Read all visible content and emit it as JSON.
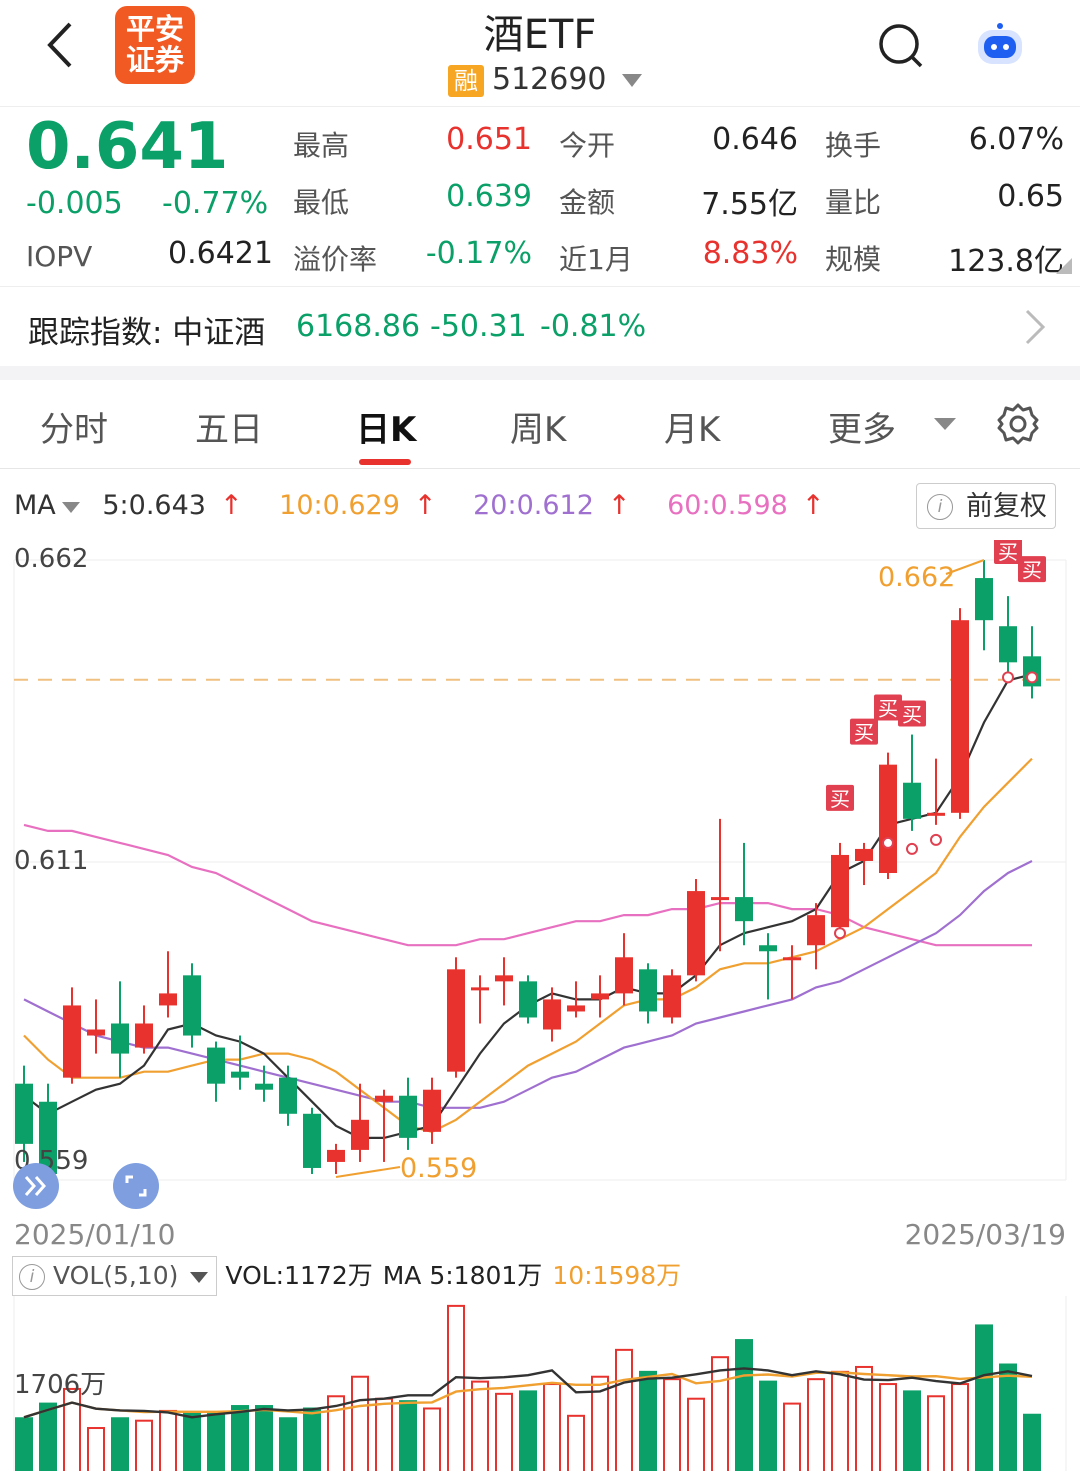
{
  "header": {
    "logo_line1": "平安",
    "logo_line2": "证券",
    "title": "酒ETF",
    "badge": "融",
    "code": "512690"
  },
  "quote": {
    "price": "0.641",
    "change": "-0.005",
    "change_pct": "-0.77%",
    "iopv_label": "IOPV",
    "iopv_value": "0.6421",
    "grid": [
      {
        "label": "最高",
        "value": "0.651",
        "color": "red"
      },
      {
        "label": "今开",
        "value": "0.646",
        "color": "dark"
      },
      {
        "label": "换手",
        "value": "6.07%",
        "color": "dark"
      },
      {
        "label": "最低",
        "value": "0.639",
        "color": "green"
      },
      {
        "label": "金额",
        "value": "7.55亿",
        "color": "dark"
      },
      {
        "label": "量比",
        "value": "0.65",
        "color": "dark"
      },
      {
        "label": "溢价率",
        "value": "-0.17%",
        "color": "green"
      },
      {
        "label": "近1月",
        "value": "8.83%",
        "color": "red"
      },
      {
        "label": "规模",
        "value": "123.8亿",
        "color": "dark"
      }
    ]
  },
  "tracking": {
    "label": "跟踪指数: 中证酒",
    "value": "6168.86",
    "change": "-50.31",
    "change_pct": "-0.81%"
  },
  "tabs": [
    "分时",
    "五日",
    "日K",
    "周K",
    "月K",
    "更多"
  ],
  "active_tab": "日K",
  "ma": {
    "label": "MA",
    "ma5": "5:0.643",
    "ma10": "10:0.629",
    "ma20": "20:0.612",
    "ma60": "60:0.598",
    "adjust": "前复权"
  },
  "colors": {
    "up": "#e8322e",
    "down": "#0aa068",
    "ma5": "#333333",
    "ma10": "#f0a030",
    "ma20": "#a070d0",
    "ma60": "#e870c0"
  },
  "chart_labels": {
    "high": "0.662",
    "mid": "0.611",
    "low": "0.559",
    "high_marker": "0.662",
    "low_marker": "0.559",
    "buy": "买",
    "date_start": "2025/01/10",
    "date_end": "2025/03/19"
  },
  "chart_data": {
    "type": "candlestick",
    "ylim": [
      0.559,
      0.662
    ],
    "candles": [
      {
        "o": 0.575,
        "c": 0.565,
        "h": 0.578,
        "l": 0.562
      },
      {
        "o": 0.572,
        "c": 0.56,
        "h": 0.575,
        "l": 0.558
      },
      {
        "o": 0.576,
        "c": 0.588,
        "h": 0.591,
        "l": 0.575
      },
      {
        "o": 0.583,
        "c": 0.584,
        "h": 0.589,
        "l": 0.58
      },
      {
        "o": 0.585,
        "c": 0.58,
        "h": 0.592,
        "l": 0.576
      },
      {
        "o": 0.581,
        "c": 0.585,
        "h": 0.588,
        "l": 0.58
      },
      {
        "o": 0.588,
        "c": 0.59,
        "h": 0.597,
        "l": 0.586
      },
      {
        "o": 0.593,
        "c": 0.583,
        "h": 0.595,
        "l": 0.581
      },
      {
        "o": 0.581,
        "c": 0.575,
        "h": 0.582,
        "l": 0.572
      },
      {
        "o": 0.577,
        "c": 0.576,
        "h": 0.583,
        "l": 0.574
      },
      {
        "o": 0.575,
        "c": 0.574,
        "h": 0.578,
        "l": 0.572
      },
      {
        "o": 0.576,
        "c": 0.57,
        "h": 0.578,
        "l": 0.568
      },
      {
        "o": 0.57,
        "c": 0.561,
        "h": 0.571,
        "l": 0.56
      },
      {
        "o": 0.562,
        "c": 0.564,
        "h": 0.565,
        "l": 0.56
      },
      {
        "o": 0.564,
        "c": 0.569,
        "h": 0.575,
        "l": 0.562
      },
      {
        "o": 0.572,
        "c": 0.573,
        "h": 0.574,
        "l": 0.562
      },
      {
        "o": 0.573,
        "c": 0.566,
        "h": 0.576,
        "l": 0.564
      },
      {
        "o": 0.567,
        "c": 0.574,
        "h": 0.576,
        "l": 0.565
      },
      {
        "o": 0.577,
        "c": 0.594,
        "h": 0.596,
        "l": 0.576
      },
      {
        "o": 0.591,
        "c": 0.591,
        "h": 0.593,
        "l": 0.585
      },
      {
        "o": 0.592,
        "c": 0.593,
        "h": 0.596,
        "l": 0.588
      },
      {
        "o": 0.592,
        "c": 0.586,
        "h": 0.593,
        "l": 0.585
      },
      {
        "o": 0.584,
        "c": 0.589,
        "h": 0.591,
        "l": 0.582
      },
      {
        "o": 0.587,
        "c": 0.588,
        "h": 0.592,
        "l": 0.586
      },
      {
        "o": 0.589,
        "c": 0.59,
        "h": 0.593,
        "l": 0.586
      },
      {
        "o": 0.59,
        "c": 0.596,
        "h": 0.6,
        "l": 0.588
      },
      {
        "o": 0.594,
        "c": 0.587,
        "h": 0.595,
        "l": 0.585
      },
      {
        "o": 0.586,
        "c": 0.593,
        "h": 0.594,
        "l": 0.585
      },
      {
        "o": 0.593,
        "c": 0.607,
        "h": 0.609,
        "l": 0.592
      },
      {
        "o": 0.606,
        "c": 0.606,
        "h": 0.619,
        "l": 0.597
      },
      {
        "o": 0.606,
        "c": 0.602,
        "h": 0.615,
        "l": 0.598
      },
      {
        "o": 0.598,
        "c": 0.597,
        "h": 0.6,
        "l": 0.589
      },
      {
        "o": 0.596,
        "c": 0.596,
        "h": 0.598,
        "l": 0.589
      },
      {
        "o": 0.598,
        "c": 0.603,
        "h": 0.605,
        "l": 0.594
      },
      {
        "o": 0.601,
        "c": 0.613,
        "h": 0.615,
        "l": 0.599
      },
      {
        "o": 0.612,
        "c": 0.614,
        "h": 0.615,
        "l": 0.608
      },
      {
        "o": 0.61,
        "c": 0.628,
        "h": 0.63,
        "l": 0.609
      },
      {
        "o": 0.625,
        "c": 0.619,
        "h": 0.633,
        "l": 0.617
      },
      {
        "o": 0.62,
        "c": 0.62,
        "h": 0.629,
        "l": 0.618
      },
      {
        "o": 0.62,
        "c": 0.652,
        "h": 0.654,
        "l": 0.619
      },
      {
        "o": 0.659,
        "c": 0.652,
        "h": 0.662,
        "l": 0.647
      },
      {
        "o": 0.651,
        "c": 0.645,
        "h": 0.656,
        "l": 0.643
      },
      {
        "o": 0.646,
        "c": 0.641,
        "h": 0.651,
        "l": 0.639
      }
    ],
    "ma5": [
      0.573,
      0.57,
      0.572,
      0.574,
      0.575,
      0.578,
      0.584,
      0.585,
      0.583,
      0.582,
      0.58,
      0.576,
      0.572,
      0.568,
      0.566,
      0.566,
      0.567,
      0.568,
      0.574,
      0.58,
      0.585,
      0.588,
      0.59,
      0.589,
      0.589,
      0.591,
      0.59,
      0.59,
      0.593,
      0.598,
      0.6,
      0.601,
      0.602,
      0.604,
      0.61,
      0.612,
      0.618,
      0.619,
      0.62,
      0.626,
      0.635,
      0.642,
      0.643
    ],
    "ma10": [
      0.583,
      0.579,
      0.576,
      0.576,
      0.576,
      0.577,
      0.577,
      0.578,
      0.579,
      0.579,
      0.58,
      0.58,
      0.579,
      0.577,
      0.574,
      0.571,
      0.568,
      0.567,
      0.569,
      0.572,
      0.575,
      0.578,
      0.58,
      0.582,
      0.585,
      0.588,
      0.589,
      0.589,
      0.591,
      0.594,
      0.595,
      0.595,
      0.596,
      0.597,
      0.599,
      0.601,
      0.604,
      0.607,
      0.61,
      0.616,
      0.621,
      0.625,
      0.629
    ],
    "ma20": [
      0.589,
      0.587,
      0.585,
      0.583,
      0.582,
      0.581,
      0.581,
      0.58,
      0.579,
      0.578,
      0.577,
      0.576,
      0.575,
      0.574,
      0.573,
      0.572,
      0.572,
      0.571,
      0.571,
      0.571,
      0.572,
      0.574,
      0.576,
      0.577,
      0.579,
      0.581,
      0.582,
      0.583,
      0.585,
      0.586,
      0.587,
      0.588,
      0.589,
      0.591,
      0.592,
      0.594,
      0.596,
      0.598,
      0.6,
      0.603,
      0.607,
      0.61,
      0.612
    ],
    "ma60": [
      0.618,
      0.617,
      0.617,
      0.616,
      0.615,
      0.614,
      0.613,
      0.611,
      0.61,
      0.608,
      0.606,
      0.604,
      0.602,
      0.601,
      0.6,
      0.599,
      0.598,
      0.598,
      0.598,
      0.599,
      0.599,
      0.6,
      0.601,
      0.602,
      0.602,
      0.603,
      0.603,
      0.604,
      0.604,
      0.605,
      0.605,
      0.605,
      0.604,
      0.604,
      0.603,
      0.601,
      0.6,
      0.599,
      0.598,
      0.598,
      0.598,
      0.598,
      0.598
    ],
    "volume": {
      "label": "VOL(5,10)",
      "readout": "VOL:1172万",
      "ma5_readout": "MA 5:1801万",
      "ma10_readout": "10:1598万",
      "axis_label": "1706万",
      "values": [
        1100,
        1400,
        1700,
        900,
        1100,
        1050,
        1250,
        1200,
        1200,
        1350,
        1350,
        1100,
        1300,
        1550,
        1950,
        1500,
        1450,
        1300,
        3400,
        1850,
        1600,
        1650,
        1800,
        1150,
        1950,
        2500,
        2050,
        1900,
        1500,
        2350,
        2700,
        1850,
        1400,
        1900,
        2050,
        2150,
        1800,
        1650,
        1550,
        1800,
        3000,
        2200,
        1172
      ]
    }
  }
}
